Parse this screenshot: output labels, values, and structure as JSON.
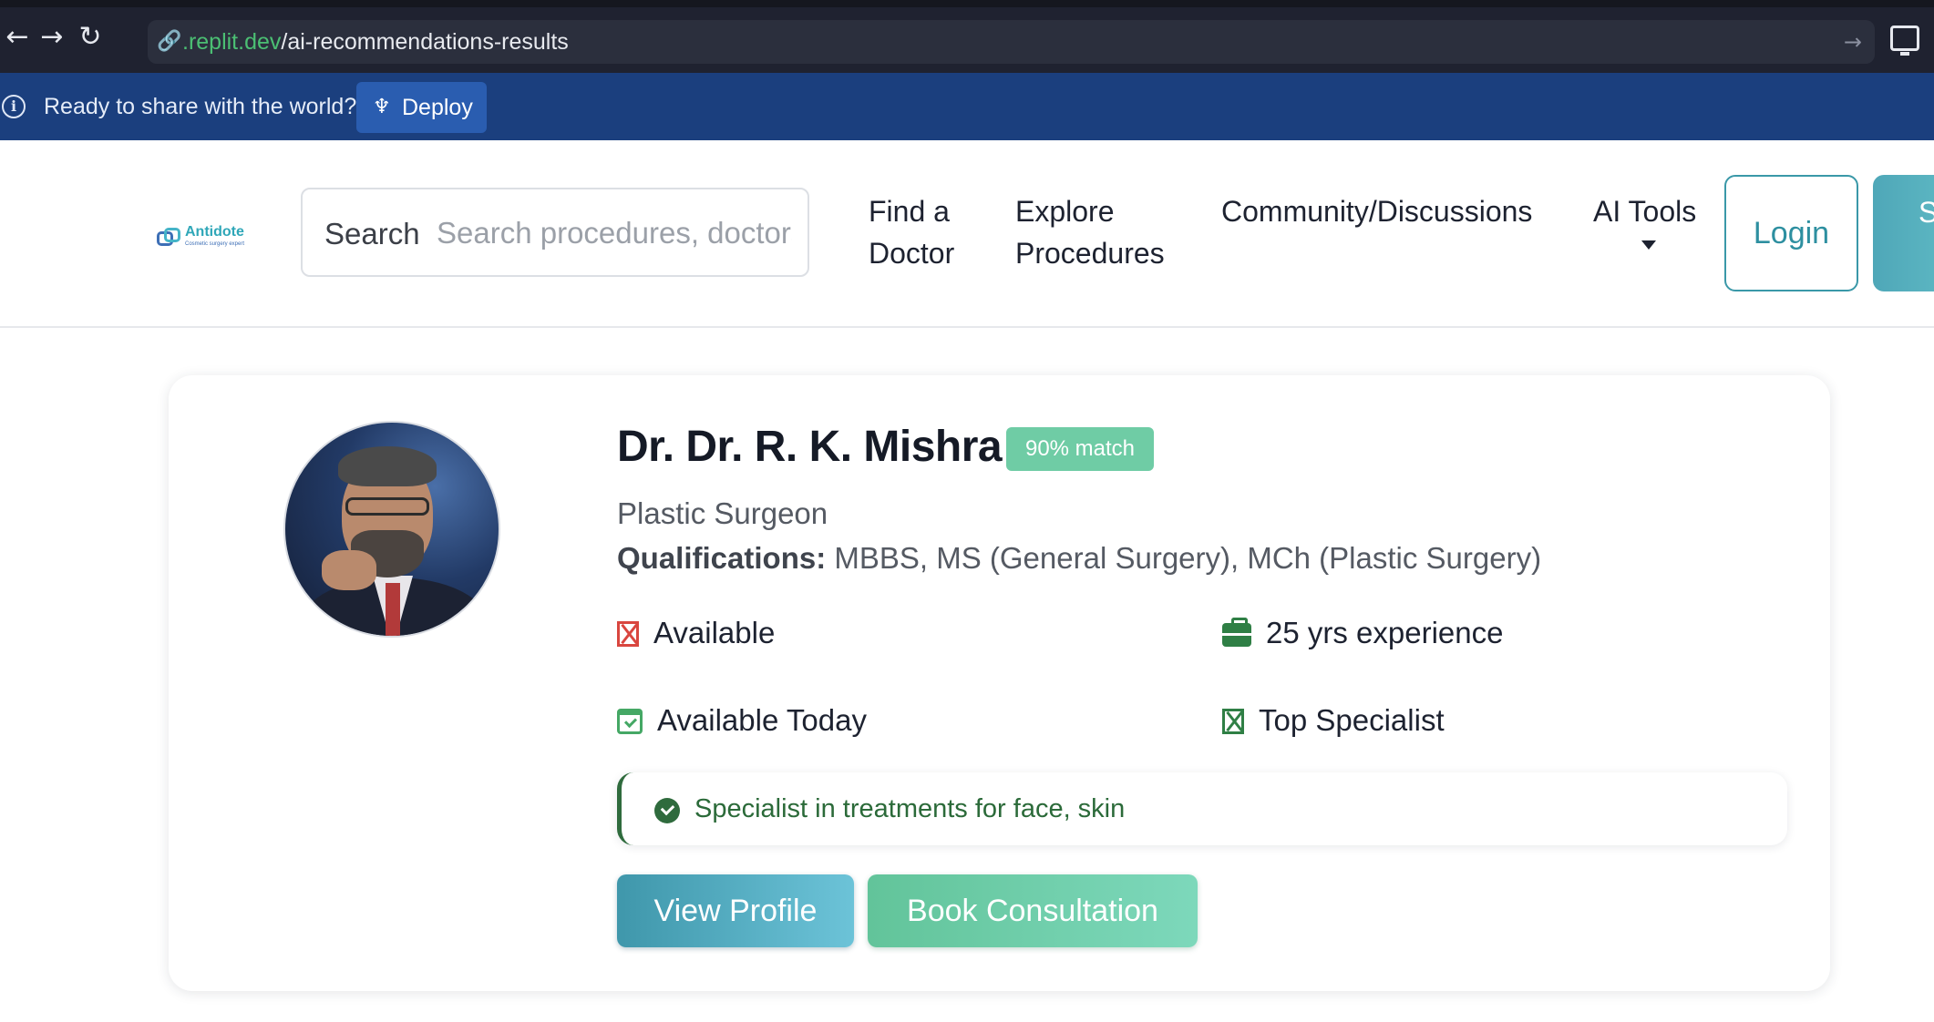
{
  "browser": {
    "url_host": ".replit.dev",
    "url_path": "/ai-recommendations-results"
  },
  "banner": {
    "message": "Ready to share with the world?",
    "deploy_label": "Deploy"
  },
  "header": {
    "logo_name": "Antidote",
    "logo_tagline": "Cosmetic surgery expert",
    "search_label": "Search",
    "search_placeholder": "Search procedures, doctors",
    "nav": {
      "find_doctor": "Find a Doctor",
      "explore_procedures": "Explore Procedures",
      "community": "Community/Discussions",
      "ai_tools": "AI Tools"
    },
    "login_label": "Login",
    "signup_label": "S"
  },
  "doctor": {
    "name": "Dr. Dr. R. K. Mishra",
    "match": "90% match",
    "specialty": "Plastic Surgeon",
    "qualifications_label": "Qualifications:",
    "qualifications_value": "MBBS, MS (General Surgery), MCh (Plastic Surgery)",
    "availability": "Available",
    "experience": "25 yrs experience",
    "available_today": "Available Today",
    "top_specialist": "Top Specialist",
    "highlight": "Specialist in treatments for face, skin",
    "view_profile_label": "View Profile",
    "book_label": "Book Consultation"
  },
  "colors": {
    "banner_bg": "#1b3f7e",
    "deploy_btn": "#2a5db0",
    "accent_teal": "#3a98a8",
    "match_badge": "#6fcca5",
    "success_green": "#2f6b3d",
    "unavailable_red": "#d9463f"
  },
  "icons": [
    "back-arrow-icon",
    "forward-arrow-icon",
    "reload-icon",
    "link-icon",
    "go-arrow-icon",
    "desktop-icon",
    "info-icon",
    "deploy-icon",
    "caret-down-icon",
    "x-box-icon",
    "briefcase-icon",
    "calendar-check-icon",
    "check-circle-icon"
  ]
}
